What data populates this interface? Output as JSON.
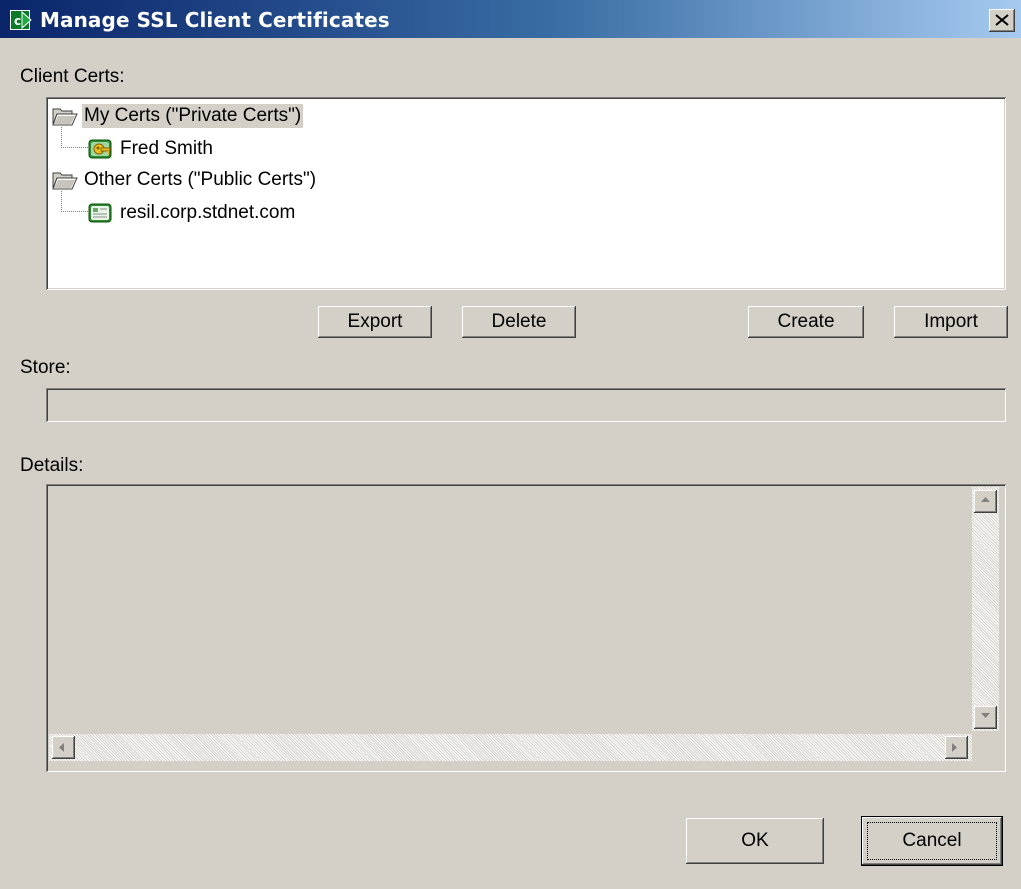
{
  "window": {
    "title": "Manage SSL Client Certificates",
    "app_icon": "app-launch-icon",
    "close_icon": "close-icon"
  },
  "client_certs": {
    "label": "Client Certs:",
    "tree": [
      {
        "label": "My Certs (\"Private Certs\")",
        "icon": "folder-open-icon",
        "selected": true,
        "children": [
          {
            "label": "Fred Smith",
            "icon": "certificate-key-icon"
          }
        ]
      },
      {
        "label": "Other Certs (\"Public Certs\")",
        "icon": "folder-open-icon",
        "selected": false,
        "children": [
          {
            "label": "resil.corp.stdnet.com",
            "icon": "certificate-icon"
          }
        ]
      }
    ]
  },
  "buttons": {
    "export": "Export",
    "delete": "Delete",
    "create": "Create",
    "import": "Import"
  },
  "store": {
    "label": "Store:",
    "value": ""
  },
  "details": {
    "label": "Details:",
    "value": ""
  },
  "footer": {
    "ok": "OK",
    "cancel": "Cancel"
  },
  "colors": {
    "titlebar_start": "#0a246a",
    "titlebar_end": "#a6caf0",
    "face": "#d4d0c8"
  }
}
